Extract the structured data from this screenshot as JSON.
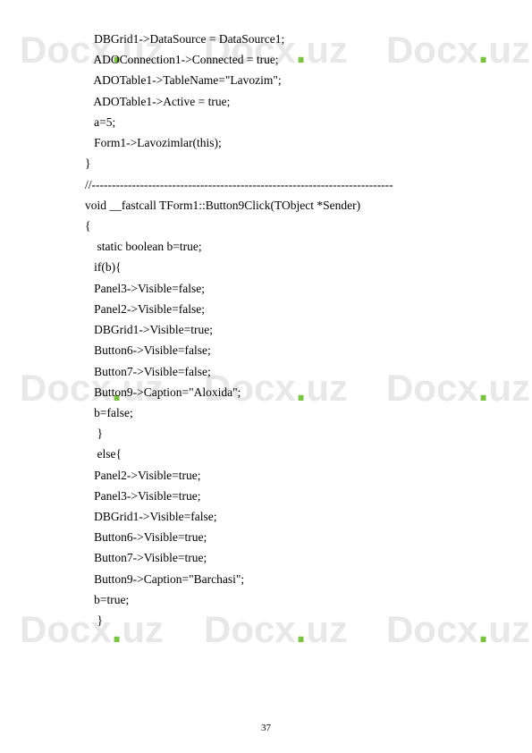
{
  "watermark": {
    "prefix": "Docx",
    "dot": ".",
    "suffix": "uz"
  },
  "code": {
    "lines": [
      "   DBGrid1->DataSource = DataSource1;",
      "   ADOConnection1->Connected = true;",
      "   ADOTable1->TableName=\"Lavozim\";",
      "   ADOTable1->Active = true;",
      "   a=5;",
      "   Form1->Lavozimlar(this);",
      "}",
      "//---------------------------------------------------------------------------",
      "void __fastcall TForm1::Button9Click(TObject *Sender)",
      "{",
      "    static boolean b=true;",
      "   if(b){",
      "   Panel3->Visible=false;",
      "   Panel2->Visible=false;",
      "   DBGrid1->Visible=true;",
      "   Button6->Visible=false;",
      "   Button7->Visible=false;",
      "   Button9->Caption=\"Aloxida\";",
      "   b=false;",
      "    }",
      "    else{",
      "",
      "   Panel2->Visible=true;",
      "   Panel3->Visible=true;",
      "   DBGrid1->Visible=false;",
      "   Button6->Visible=true;",
      "   Button7->Visible=true;",
      "   Button9->Caption=\"Barchasi\";",
      "   b=true;",
      "    }"
    ]
  },
  "page": {
    "number": "37"
  }
}
